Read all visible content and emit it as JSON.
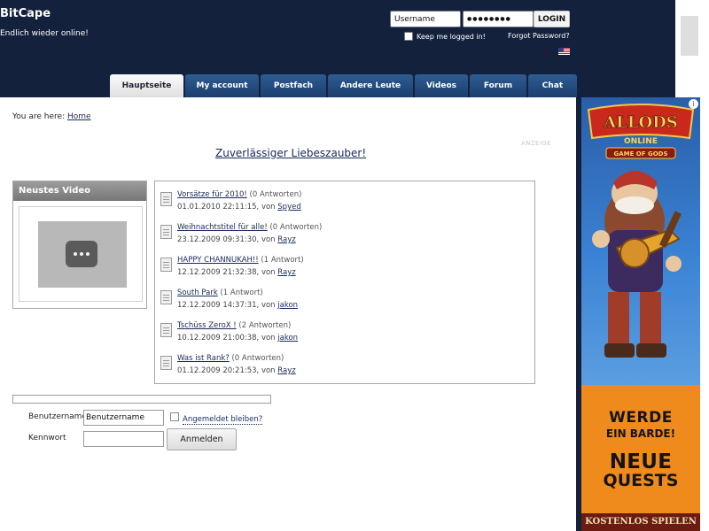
{
  "site": {
    "title": "BitCape",
    "tagline": "Endlich wieder online!"
  },
  "header_login": {
    "username_value": "Username",
    "password_value": "●●●●●●●●",
    "login_label": "LOGIN",
    "remember_label": "Keep me logged in!",
    "forgot_label": "Forgot Password?",
    "language_flag": "us-flag-icon"
  },
  "nav": {
    "tabs": [
      {
        "label": "Hauptseite",
        "active": true
      },
      {
        "label": "My account",
        "active": false
      },
      {
        "label": "Postfach",
        "active": false
      },
      {
        "label": "Andere Leute",
        "active": false
      },
      {
        "label": "Videos",
        "active": false
      },
      {
        "label": "Forum",
        "active": false
      },
      {
        "label": "Chat",
        "active": false
      }
    ]
  },
  "breadcrumb": {
    "prefix": "You are here:",
    "home_label": "Home"
  },
  "promo": {
    "tag": "ANZEIGE",
    "link_text": "Zuverlässiger Liebeszauber!"
  },
  "video": {
    "heading": "Neustes Video"
  },
  "threads": [
    {
      "title": "Vorsätze für 2010!",
      "replies": "(0 Antworten)",
      "date": "01.01.2010 22:11:15, von",
      "author": "Spyed"
    },
    {
      "title": "Weihnachtstitel für alle!",
      "replies": "(0 Antworten)",
      "date": "23.12.2009 09:31:30, von",
      "author": "Rayz"
    },
    {
      "title": "HAPPY CHANNUKAH!!",
      "replies": "(1 Antwort)",
      "date": "12.12.2009 21:32:38, von",
      "author": "Rayz"
    },
    {
      "title": "South Park",
      "replies": "(1 Antwort)",
      "date": "12.12.2009 14:37:31, von",
      "author": "jakon"
    },
    {
      "title": "Tschüss ZeroX !",
      "replies": "(2 Antworten)",
      "date": "10.12.2009 21:00:38, von",
      "author": "jakon"
    },
    {
      "title": "Was ist Rank?",
      "replies": "(0 Antworten)",
      "date": "01.12.2009 20:21:53, von",
      "author": "Rayz"
    }
  ],
  "login_form": {
    "username_label": "Benutzername",
    "username_value": "Benutzername",
    "remember_label": "Angemeldet bleiben?",
    "password_label": "Kennwort",
    "submit_label": "Anmelden"
  },
  "ad": {
    "brand": "ALLODS",
    "brand_sub": "ONLINE",
    "brand_motto": "GAME OF GODS",
    "line1": "WERDE",
    "line2": "EIN BARDE!",
    "line3": "NEUE",
    "line4": "QUESTS",
    "cta": "KOSTENLOS SPIELEN",
    "info_icon": "info-icon"
  },
  "colors": {
    "header_bg": "#14213d",
    "tab_blue": "#2e5c92",
    "link": "#1a2a5a",
    "ad_orange": "#ef8a1c"
  }
}
